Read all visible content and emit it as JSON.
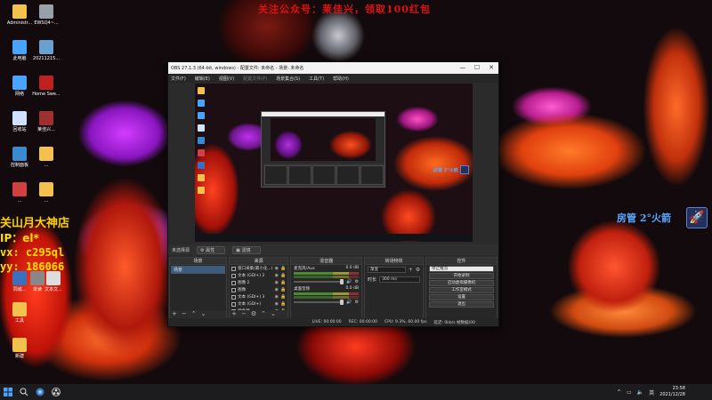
{
  "banner": "关注公众号：莱佳兴，领取100红包",
  "overlay": {
    "store": "关山月大神店",
    "ip": "IP：el*",
    "vx": "vx: c295ql",
    "yy": "yy: 186066",
    "rocket_label": "房管 2°火箭"
  },
  "desktop_icons": [
    {
      "label": "Administr...",
      "icon": "folder-icon",
      "color": "#f2c14e"
    },
    {
      "label": "EWSQ4~...",
      "icon": "file-icon",
      "color": "#9aa0a8"
    },
    {
      "label": "此电脑",
      "icon": "computer-icon",
      "color": "#4aa3ff"
    },
    {
      "label": "20211215...",
      "icon": "file-icon",
      "color": "#6aa0d0"
    },
    {
      "label": "网络",
      "icon": "network-icon",
      "color": "#4aa3ff"
    },
    {
      "label": "Home Swe...",
      "icon": "app-icon",
      "color": "#c02020"
    },
    {
      "label": "回收站",
      "icon": "recycle-bin-icon",
      "color": "#cfe3ff"
    },
    {
      "label": "莱佳兴...",
      "icon": "app-icon",
      "color": "#a03030"
    },
    {
      "label": "控制面板",
      "icon": "control-panel-icon",
      "color": "#3a8ad0"
    },
    {
      "label": "...",
      "icon": "folder-icon",
      "color": "#f2c14e"
    },
    {
      "label": "...",
      "icon": "app-icon",
      "color": "#d04040"
    },
    {
      "label": "...",
      "icon": "folder-icon",
      "color": "#f2c14e"
    },
    {
      "label": "同城...",
      "icon": "app-icon",
      "color": "#3a70c0"
    },
    {
      "label": "未读",
      "icon": "file-icon",
      "color": "#888"
    },
    {
      "label": "文本文...",
      "icon": "text-file-icon",
      "color": "#ddd"
    },
    {
      "label": "工具",
      "icon": "folder-icon",
      "color": "#f2c14e"
    },
    {
      "label": "新建",
      "icon": "folder-icon",
      "color": "#f2c14e"
    }
  ],
  "obs": {
    "title": "OBS 27.1.3 (64-bit, windows) - 配置文件: 未命名 - 场景: 未命名",
    "window_buttons": [
      "—",
      "☐",
      "✕"
    ],
    "menu": [
      "文件(F)",
      "编辑(E)",
      "视图(V)",
      "配置文件(P)",
      "场景集合(S)",
      "工具(T)",
      "帮助(H)"
    ],
    "preview_rocket": "房管 2°火箭",
    "ctrl_strip": {
      "no_source": "未选择源",
      "properties": "属性",
      "filters": "滤镜"
    },
    "docks": {
      "scenes": {
        "title": "场景",
        "items": [
          "场景"
        ]
      },
      "sources": {
        "title": "来源",
        "items": [
          "窗口采集(最小化...)",
          "文本 (GDI+) 2",
          "图像 2",
          "图像",
          "文本 (GDI+) 3",
          "文本 (GDI+)",
          "颜色源"
        ]
      },
      "mixer": {
        "title": "混音器",
        "channels": [
          {
            "name": "麦克风/Aux",
            "level": "0.0 dB"
          },
          {
            "name": "桌面音频",
            "level": "0.0 dB"
          }
        ]
      },
      "transitions": {
        "title": "转场特效",
        "type": "渐变",
        "duration_label": "时长",
        "duration": "300 ms"
      },
      "controls": {
        "title": "控件",
        "buttons": [
          "停止推流",
          "开始录制",
          "启动虚拟摄像机",
          "工作室模式",
          "设置",
          "退出"
        ]
      }
    },
    "status": {
      "live": "LIVE: 00:00:00",
      "rec": "REC: 00:00:00",
      "cpu": "CPU: 9.3%, 60.00 fps",
      "kb": "延迟: 0kb/s 帧数据(00"
    }
  },
  "taskbar": {
    "tray_caret": "^",
    "time": "23:58",
    "date": "2021/12/28"
  }
}
